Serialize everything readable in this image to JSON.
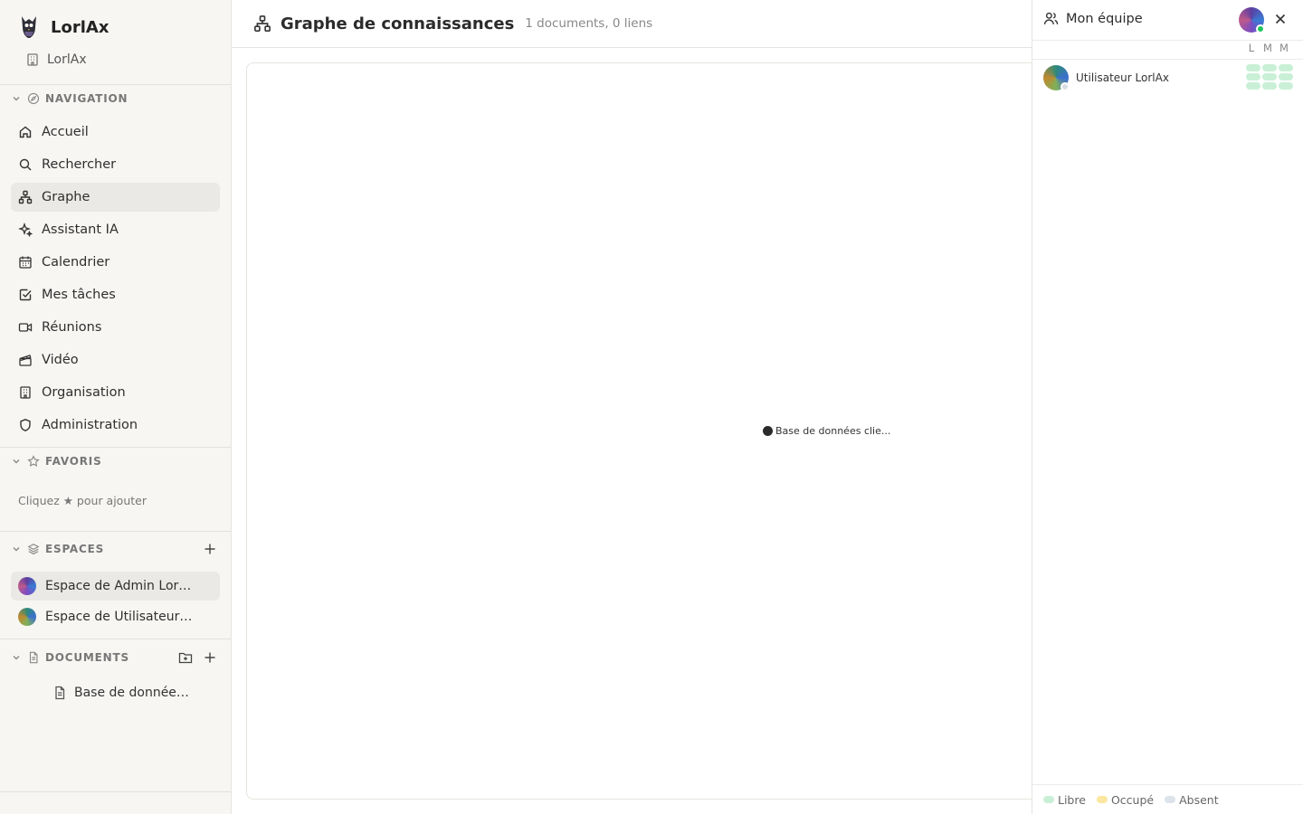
{
  "app": {
    "name": "LorlAx",
    "org": "LorlAx"
  },
  "sections": {
    "navigation": "NAVIGATION",
    "favorites": "FAVORIS",
    "spaces": "ESPACES",
    "documents": "DOCUMENTS"
  },
  "nav": {
    "items": [
      {
        "label": "Accueil",
        "icon": "home-icon"
      },
      {
        "label": "Rechercher",
        "icon": "search-icon"
      },
      {
        "label": "Graphe",
        "icon": "graph-icon",
        "active": true
      },
      {
        "label": "Assistant IA",
        "icon": "sparkles-icon"
      },
      {
        "label": "Calendrier",
        "icon": "calendar-icon"
      },
      {
        "label": "Mes tâches",
        "icon": "checkbox-icon"
      },
      {
        "label": "Réunions",
        "icon": "video-camera-icon"
      },
      {
        "label": "Vidéo",
        "icon": "clapperboard-icon"
      },
      {
        "label": "Organisation",
        "icon": "building-icon"
      },
      {
        "label": "Administration",
        "icon": "shield-icon"
      }
    ]
  },
  "favorites": {
    "hint": "Cliquez ★ pour ajouter"
  },
  "spaces": {
    "items": [
      {
        "label": "Espace de Admin LorlAx",
        "active": true
      },
      {
        "label": "Espace de Utilisateur LorlAx"
      }
    ]
  },
  "documents": {
    "items": [
      {
        "label": "Base de données clients"
      }
    ]
  },
  "header": {
    "title": "Graphe de connaissances",
    "subtitle": "1 documents, 0 liens"
  },
  "graph": {
    "nodes": [
      {
        "label": "Base de données clie..."
      }
    ]
  },
  "team": {
    "title": "Mon équipe",
    "days": [
      "L",
      "M",
      "M"
    ],
    "members": [
      {
        "name": "Utilisateur LorlAx"
      }
    ],
    "legend": [
      {
        "label": "Libre",
        "color": "#c9f0d6"
      },
      {
        "label": "Occupé",
        "color": "#fbe7a0"
      },
      {
        "label": "Absent",
        "color": "#dde3ea"
      }
    ]
  }
}
